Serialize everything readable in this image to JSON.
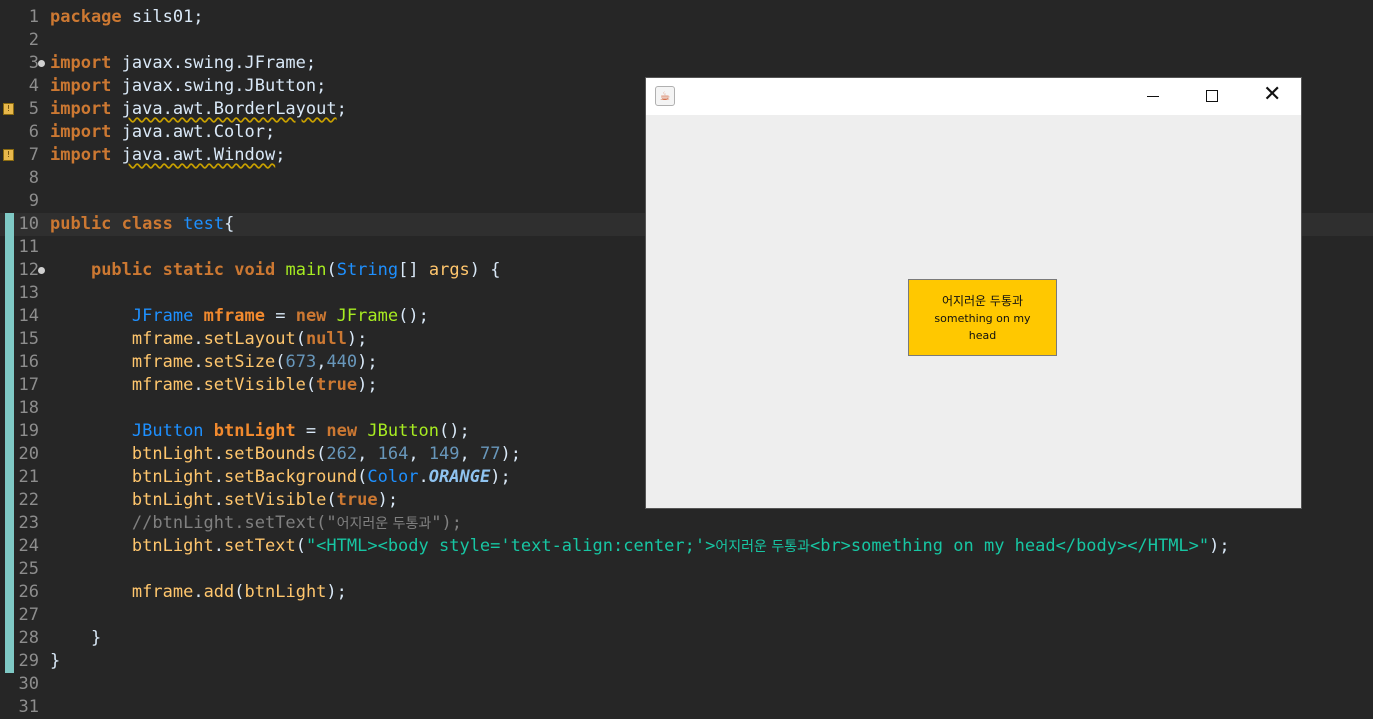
{
  "editor": {
    "lines": [
      {
        "num": "1",
        "tokens": [
          [
            "kw",
            "package"
          ],
          [
            "p",
            " sils01;"
          ]
        ]
      },
      {
        "num": "2",
        "tokens": []
      },
      {
        "num": "3",
        "marker": "fold",
        "tokens": [
          [
            "kw",
            "import"
          ],
          [
            "p",
            " javax.swing.JFrame;"
          ]
        ]
      },
      {
        "num": "4",
        "tokens": [
          [
            "kw",
            "import"
          ],
          [
            "p",
            " javax.swing.JButton;"
          ]
        ]
      },
      {
        "num": "5",
        "marker": "warning",
        "tokens": [
          [
            "kw",
            "import"
          ],
          [
            "p",
            " "
          ],
          [
            "warn",
            "java.awt.BorderLayout"
          ],
          [
            "p",
            ";"
          ]
        ]
      },
      {
        "num": "6",
        "tokens": [
          [
            "kw",
            "import"
          ],
          [
            "p",
            " java.awt.Color;"
          ]
        ]
      },
      {
        "num": "7",
        "marker": "warning",
        "tokens": [
          [
            "kw",
            "import"
          ],
          [
            "p",
            " "
          ],
          [
            "warn",
            "java.awt.Window"
          ],
          [
            "p",
            ";"
          ]
        ]
      },
      {
        "num": "8",
        "tokens": []
      },
      {
        "num": "9",
        "tokens": []
      },
      {
        "num": "10",
        "current": true,
        "tokens": [
          [
            "kw",
            "public"
          ],
          [
            "p",
            " "
          ],
          [
            "kw",
            "class"
          ],
          [
            "p",
            " "
          ],
          [
            "type",
            "test"
          ],
          [
            "p",
            "{"
          ]
        ]
      },
      {
        "num": "11",
        "tokens": []
      },
      {
        "num": "12",
        "marker": "fold",
        "tokens": [
          [
            "p",
            "    "
          ],
          [
            "kw",
            "public"
          ],
          [
            "p",
            " "
          ],
          [
            "kw",
            "static"
          ],
          [
            "p",
            " "
          ],
          [
            "kw",
            "void"
          ],
          [
            "p",
            " "
          ],
          [
            "meth",
            "main"
          ],
          [
            "p",
            "("
          ],
          [
            "type",
            "String"
          ],
          [
            "p",
            "[] "
          ],
          [
            "m",
            "args"
          ],
          [
            "p",
            ") {"
          ]
        ]
      },
      {
        "num": "13",
        "tokens": []
      },
      {
        "num": "14",
        "tokens": [
          [
            "p",
            "        "
          ],
          [
            "type",
            "JFrame"
          ],
          [
            "p",
            " "
          ],
          [
            "var",
            "mframe"
          ],
          [
            "p",
            " = "
          ],
          [
            "kw",
            "new"
          ],
          [
            "p",
            " "
          ],
          [
            "meth",
            "JFrame"
          ],
          [
            "p",
            "();"
          ]
        ]
      },
      {
        "num": "15",
        "tokens": [
          [
            "p",
            "        "
          ],
          [
            "m",
            "mframe"
          ],
          [
            "p",
            "."
          ],
          [
            "m",
            "setLayout"
          ],
          [
            "p",
            "("
          ],
          [
            "kw",
            "null"
          ],
          [
            "p",
            ");"
          ]
        ]
      },
      {
        "num": "16",
        "tokens": [
          [
            "p",
            "        "
          ],
          [
            "m",
            "mframe"
          ],
          [
            "p",
            "."
          ],
          [
            "m",
            "setSize"
          ],
          [
            "p",
            "("
          ],
          [
            "numl",
            "673"
          ],
          [
            "p",
            ","
          ],
          [
            "numl",
            "440"
          ],
          [
            "p",
            ");"
          ]
        ]
      },
      {
        "num": "17",
        "tokens": [
          [
            "p",
            "        "
          ],
          [
            "m",
            "mframe"
          ],
          [
            "p",
            "."
          ],
          [
            "m",
            "setVisible"
          ],
          [
            "p",
            "("
          ],
          [
            "kw",
            "true"
          ],
          [
            "p",
            ");"
          ]
        ]
      },
      {
        "num": "18",
        "tokens": []
      },
      {
        "num": "19",
        "tokens": [
          [
            "p",
            "        "
          ],
          [
            "type",
            "JButton"
          ],
          [
            "p",
            " "
          ],
          [
            "var",
            "btnLight"
          ],
          [
            "p",
            " = "
          ],
          [
            "kw",
            "new"
          ],
          [
            "p",
            " "
          ],
          [
            "meth",
            "JButton"
          ],
          [
            "p",
            "();"
          ]
        ]
      },
      {
        "num": "20",
        "tokens": [
          [
            "p",
            "        "
          ],
          [
            "m",
            "btnLight"
          ],
          [
            "p",
            "."
          ],
          [
            "m",
            "setBounds"
          ],
          [
            "p",
            "("
          ],
          [
            "numl",
            "262"
          ],
          [
            "p",
            ", "
          ],
          [
            "numl",
            "164"
          ],
          [
            "p",
            ", "
          ],
          [
            "numl",
            "149"
          ],
          [
            "p",
            ", "
          ],
          [
            "numl",
            "77"
          ],
          [
            "p",
            ");"
          ]
        ]
      },
      {
        "num": "21",
        "tokens": [
          [
            "p",
            "        "
          ],
          [
            "m",
            "btnLight"
          ],
          [
            "p",
            "."
          ],
          [
            "m",
            "setBackground"
          ],
          [
            "p",
            "("
          ],
          [
            "type",
            "Color"
          ],
          [
            "p",
            "."
          ],
          [
            "const",
            "ORANGE"
          ],
          [
            "p",
            ");"
          ]
        ]
      },
      {
        "num": "22",
        "tokens": [
          [
            "p",
            "        "
          ],
          [
            "m",
            "btnLight"
          ],
          [
            "p",
            "."
          ],
          [
            "m",
            "setVisible"
          ],
          [
            "p",
            "("
          ],
          [
            "kw",
            "true"
          ],
          [
            "p",
            ");"
          ]
        ]
      },
      {
        "num": "23",
        "tokens": [
          [
            "p",
            "        "
          ],
          [
            "cmt",
            "//btnLight.setText(\""
          ],
          [
            "cmtko",
            "어지러운 두통과"
          ],
          [
            "cmt",
            "\");"
          ]
        ]
      },
      {
        "num": "24",
        "tokens": [
          [
            "p",
            "        "
          ],
          [
            "m",
            "btnLight"
          ],
          [
            "p",
            "."
          ],
          [
            "m",
            "setText"
          ],
          [
            "p",
            "("
          ],
          [
            "str",
            "\"<HTML><body style='text-align:center;'>"
          ],
          [
            "strko",
            "어지러운 두통과"
          ],
          [
            "str",
            "<br>something on my head</body></HTML>\""
          ],
          [
            "p",
            ");"
          ]
        ]
      },
      {
        "num": "25",
        "tokens": []
      },
      {
        "num": "26",
        "tokens": [
          [
            "p",
            "        "
          ],
          [
            "m",
            "mframe"
          ],
          [
            "p",
            "."
          ],
          [
            "m",
            "add"
          ],
          [
            "p",
            "("
          ],
          [
            "m",
            "btnLight"
          ],
          [
            "p",
            ");"
          ]
        ]
      },
      {
        "num": "27",
        "tokens": []
      },
      {
        "num": "28",
        "tokens": [
          [
            "p",
            "    }"
          ]
        ]
      },
      {
        "num": "29",
        "tokens": [
          [
            "p",
            "}"
          ]
        ]
      },
      {
        "num": "30",
        "tokens": []
      },
      {
        "num": "31",
        "tokens": []
      }
    ]
  },
  "jframe": {
    "title": "",
    "icon": "java-coffee-icon",
    "controls": {
      "minimize": "minimize-icon",
      "maximize": "maximize-icon",
      "close": "close-icon"
    },
    "button": {
      "line1": "어지러운 두통과",
      "line2": "something on my head",
      "background": "#ffc800"
    }
  },
  "colors": {
    "editor_bg": "#262626",
    "keyword": "#cc7832",
    "type": "#1e90ff",
    "string": "#17c6a3",
    "number": "#6897bb",
    "window_bg": "#eeeeee"
  }
}
